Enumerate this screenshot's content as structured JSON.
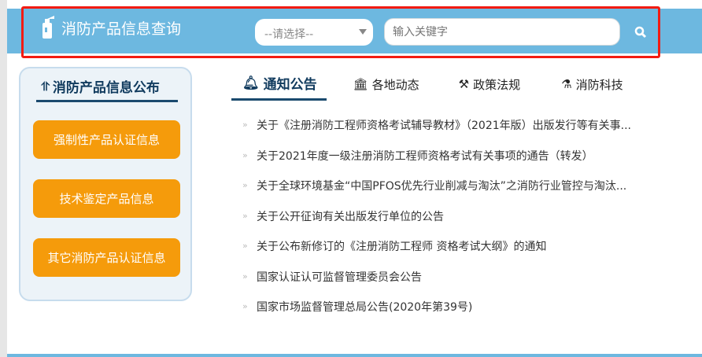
{
  "header": {
    "title": "消防产品信息查询",
    "select_value": "--请选择--",
    "search_placeholder": "输入关键字"
  },
  "sidebar": {
    "title": "消防产品信息公布",
    "buttons": [
      "强制性产品认证信息",
      "技术鉴定产品信息",
      "其它消防产品认证信息"
    ]
  },
  "tabs": [
    {
      "label": "通知公告",
      "icon": "bell-icon"
    },
    {
      "label": "各地动态",
      "icon": "bank-icon"
    },
    {
      "label": "政策法规",
      "icon": "gavel-icon"
    },
    {
      "label": "消防科技",
      "icon": "flask-icon"
    }
  ],
  "news": [
    "关于《注册消防工程师资格考试辅导教材》（2021年版）出版发行等有关事...",
    "关于2021年度一级注册消防工程师资格考试有关事项的通告（转发）",
    "关于全球环境基金“中国PFOS优先行业削减与淘汰”之消防行业管控与淘汰...",
    "关于公开征询有关出版发行单位的公告",
    "关于公布新修订的《注册消防工程师 资格考试大纲》的通知",
    "国家认证认可监督管理委员会公告",
    "国家市场监督管理总局公告(2020年第39号)"
  ],
  "colors": {
    "header": "#6db8e0",
    "accent": "#f59b0b",
    "dark": "#113b5e"
  }
}
